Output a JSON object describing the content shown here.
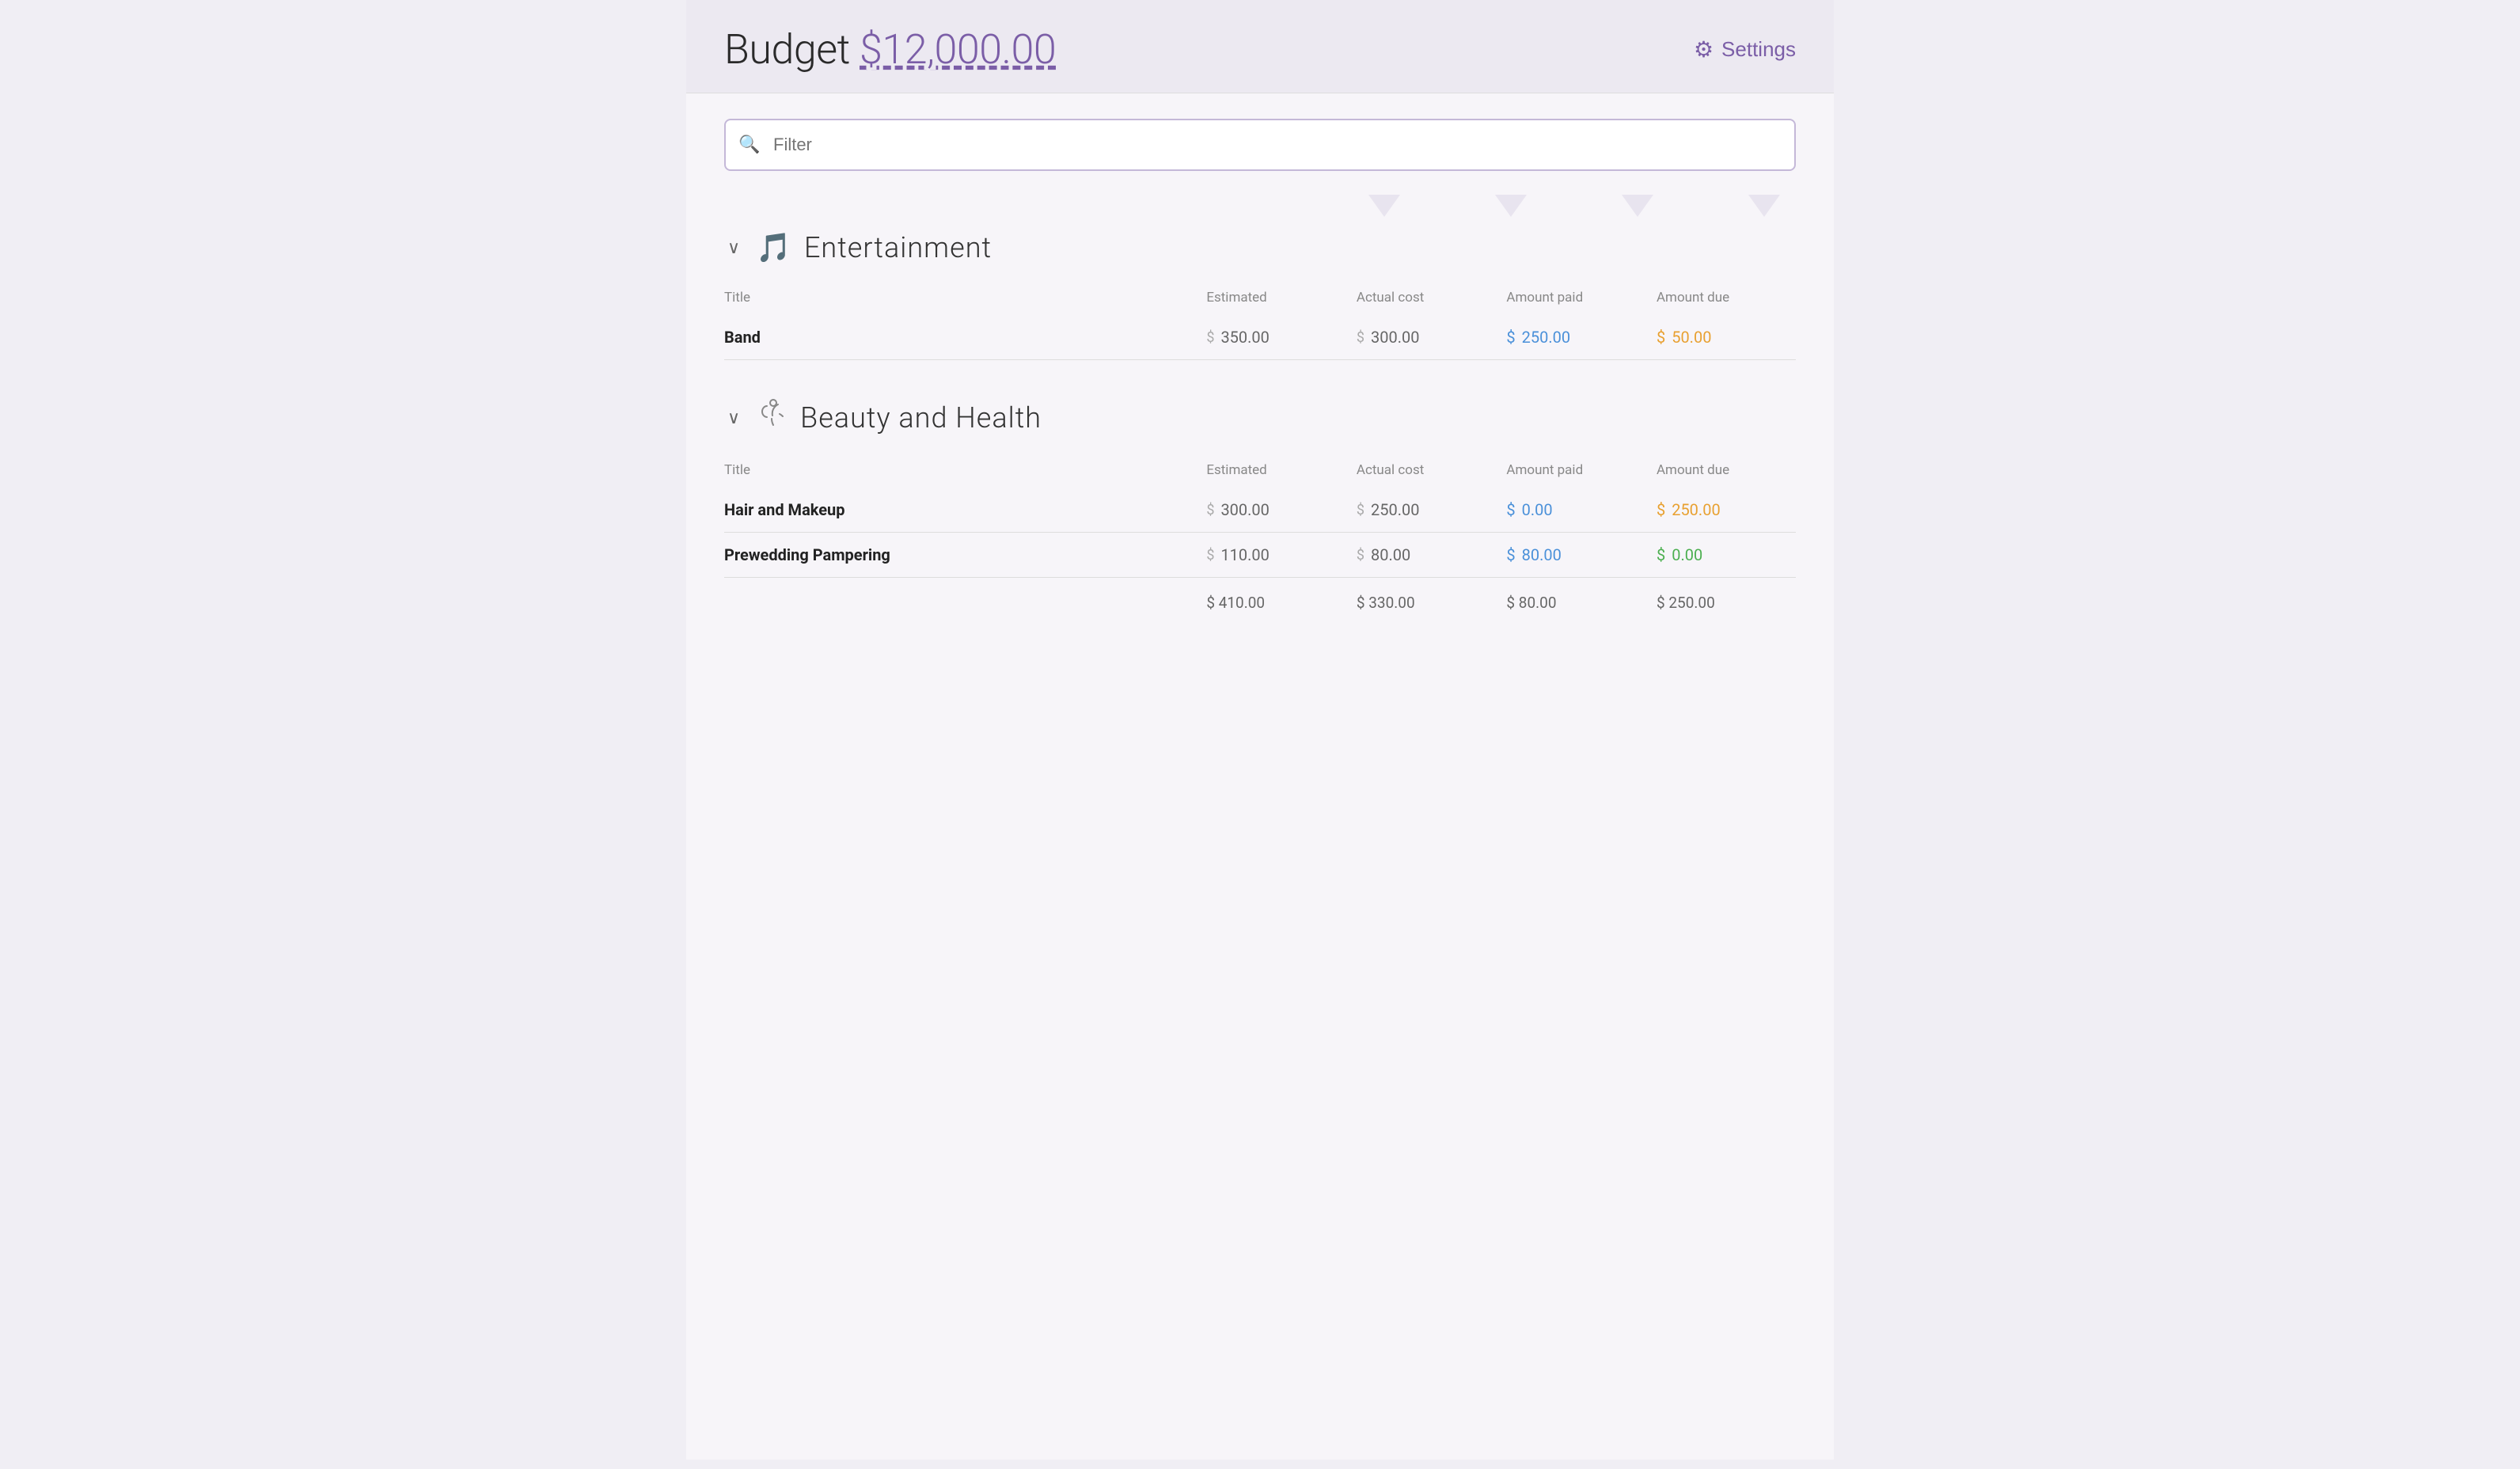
{
  "header": {
    "title_prefix": "Budget",
    "budget_amount": "$12,000.00",
    "settings_label": "Settings"
  },
  "filter": {
    "placeholder": "Filter"
  },
  "categories": [
    {
      "id": "entertainment",
      "icon": "♩♪♫",
      "title": "Entertainment",
      "columns": {
        "title": "Title",
        "estimated": "Estimated",
        "actual_cost": "Actual cost",
        "amount_paid": "Amount paid",
        "amount_due": "Amount due"
      },
      "items": [
        {
          "title": "Band",
          "estimated": "350.00",
          "actual_cost": "300.00",
          "amount_paid": "250.00",
          "amount_due": "50.00",
          "paid_color": "blue",
          "due_color": "orange"
        }
      ],
      "show_totals": false
    },
    {
      "id": "beauty-health",
      "icon": "💨",
      "title": "Beauty and Health",
      "columns": {
        "title": "Title",
        "estimated": "Estimated",
        "actual_cost": "Actual cost",
        "amount_paid": "Amount paid",
        "amount_due": "Amount due"
      },
      "items": [
        {
          "title": "Hair and Makeup",
          "estimated": "300.00",
          "actual_cost": "250.00",
          "amount_paid": "0.00",
          "amount_due": "250.00",
          "paid_color": "blue",
          "due_color": "orange"
        },
        {
          "title": "Prewedding Pampering",
          "estimated": "110.00",
          "actual_cost": "80.00",
          "amount_paid": "80.00",
          "amount_due": "0.00",
          "paid_color": "blue",
          "due_color": "green"
        }
      ],
      "totals": {
        "estimated": "$ 410.00",
        "actual_cost": "$ 330.00",
        "amount_paid": "$ 80.00",
        "amount_due": "$ 250.00"
      },
      "show_totals": true
    }
  ]
}
